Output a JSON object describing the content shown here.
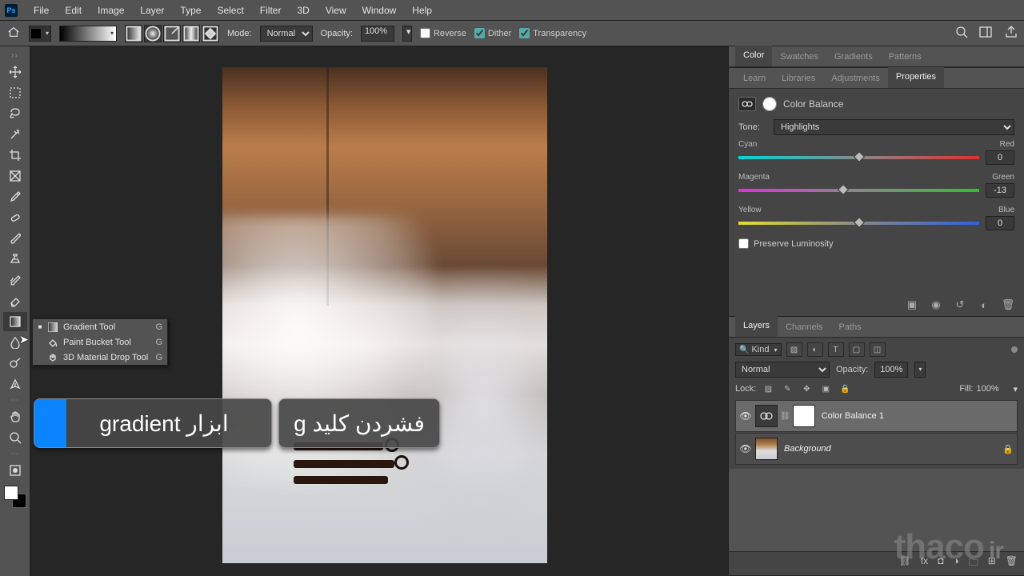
{
  "menubar": [
    "File",
    "Edit",
    "Image",
    "Layer",
    "Type",
    "Select",
    "Filter",
    "3D",
    "View",
    "Window",
    "Help"
  ],
  "optbar": {
    "mode_label": "Mode:",
    "mode_value": "Normal",
    "opacity_label": "Opacity:",
    "opacity_value": "100%",
    "reverse": "Reverse",
    "dither": "Dither",
    "transparency": "Transparency"
  },
  "tool_flyout": [
    {
      "name": "Gradient Tool",
      "key": "G",
      "selected": true
    },
    {
      "name": "Paint Bucket Tool",
      "key": "G",
      "selected": false
    },
    {
      "name": "3D Material Drop Tool",
      "key": "G",
      "selected": false
    }
  ],
  "tooltips": {
    "tip1": "ابزار gradient",
    "tip2": "فشردن کلید g"
  },
  "right_top_tabs": [
    "Color",
    "Swatches",
    "Gradients",
    "Patterns"
  ],
  "right_mid_tabs": [
    "Learn",
    "Libraries",
    "Adjustments",
    "Properties"
  ],
  "right_mid_active": "Properties",
  "properties": {
    "title": "Color Balance",
    "tone_label": "Tone:",
    "tone_value": "Highlights",
    "sliders": [
      {
        "left": "Cyan",
        "right": "Red",
        "value": "0",
        "pos": 50,
        "cls": "cyan-red"
      },
      {
        "left": "Magenta",
        "right": "Green",
        "value": "-13",
        "pos": 43.5,
        "cls": "mag-grn"
      },
      {
        "left": "Yellow",
        "right": "Blue",
        "value": "0",
        "pos": 50,
        "cls": "yel-blu"
      }
    ],
    "preserve": "Preserve Luminosity"
  },
  "layers_tabs": [
    "Layers",
    "Channels",
    "Paths"
  ],
  "layers_filter_label": "Kind",
  "layers": {
    "blend": "Normal",
    "opacity_label": "Opacity:",
    "opacity_value": "100%",
    "lock_label": "Lock:",
    "fill_label": "Fill:",
    "fill_value": "100%",
    "rows": [
      {
        "name": "Color Balance 1",
        "selected": true,
        "adjustment": true
      },
      {
        "name": "Background",
        "selected": false,
        "locked": true
      }
    ]
  },
  "watermark": {
    "a": "thaco",
    "b": "ir"
  }
}
